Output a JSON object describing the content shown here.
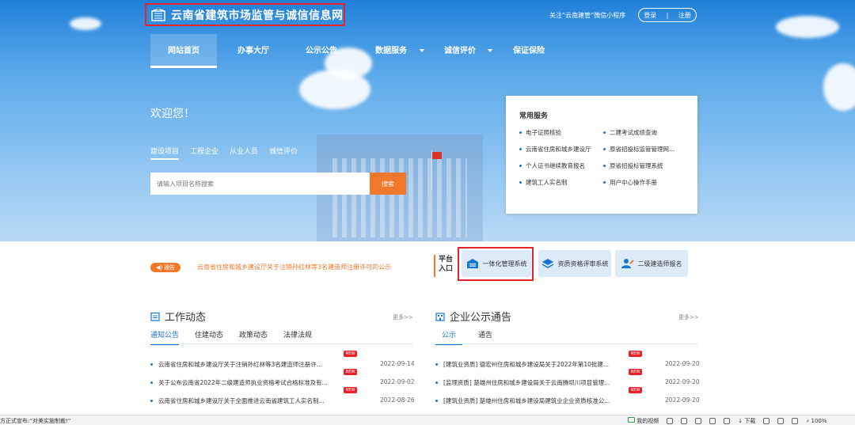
{
  "header": {
    "site_title": "云南省建筑市场监管与诚信信息网",
    "follow_text": "关注“云南建管”微信小程序",
    "login": "登录",
    "separator": "|",
    "register": "注册"
  },
  "nav": {
    "items": [
      {
        "label": "网站首页"
      },
      {
        "label": "办事大厅"
      },
      {
        "label": "公示公告"
      },
      {
        "label": "数据服务"
      },
      {
        "label": "诚信评价"
      },
      {
        "label": "保证保险"
      }
    ]
  },
  "hero": {
    "welcome": "欢迎您！",
    "search_tabs": [
      "建设项目",
      "工程企业",
      "从业人员",
      "诚信评价"
    ],
    "search_placeholder": "请输入项目名称搜索",
    "search_button": "搜索"
  },
  "services": {
    "title": "常用服务",
    "items": [
      "电子证照核验",
      "二建考试成绩查询",
      "云南省住房和城乡建设厅",
      "原省招投标监管管理网...",
      "个人证书继续教育报名",
      "原省招投标管理系统",
      "建筑工人实名制",
      "用户中心操作手册"
    ]
  },
  "notice": {
    "badge": "通告",
    "text": "云南省住房和城乡建设厅关于注销孙红林等3名建造师注册许可的公示"
  },
  "platform": {
    "label_line1": "平台",
    "label_line2": "入口",
    "buttons": [
      "一体化管理系统",
      "资质资格评审系统",
      "二级建造师报名"
    ]
  },
  "work_news": {
    "title": "工作动态",
    "more": "更多>>",
    "tabs": [
      "通知公告",
      "住建动态",
      "政策动态",
      "法律法规"
    ],
    "items": [
      {
        "text": "云南省住房和城乡建设厅关于注销孙红林等3名建造师注册许...",
        "new": "NEW",
        "date": "2022-09-14"
      },
      {
        "text": "关于公布云南省2022年二级建造师执业资格考试合格标准及有...",
        "new": "NEW",
        "date": "2022-09-02"
      },
      {
        "text": "云南省住房和城乡建设厅关于全面推进云南省建筑工人实名制...",
        "new": "NEW",
        "date": "2022-08-26"
      }
    ]
  },
  "enterprise_news": {
    "title": "企业公示通告",
    "more": "更多>>",
    "tabs": [
      "公示",
      "通告"
    ],
    "items": [
      {
        "text": "[建筑业资质] 德宏州住房和城乡建设局关于2022年第10批建...",
        "new": "NEW",
        "date": "2022-09-20"
      },
      {
        "text": "[监理资质] 楚雄州住房和城乡建设局关于云南腾坝川项目管理...",
        "new": "NEW",
        "date": "2022-09-20"
      },
      {
        "text": "[建筑业资质] 楚雄州住房和城乡建设局建筑业企业资质核准公...",
        "new": "NEW",
        "date": "2022-09-20"
      }
    ]
  },
  "statusbar": {
    "left": "方正式宣布:“对美实施制裁!”",
    "video": "我的视频",
    "download": "下载",
    "zoom": "100%"
  },
  "colors": {
    "brand_blue": "#1677d2",
    "accent_orange": "#f0782a",
    "highlight_red": "#e8232a"
  }
}
